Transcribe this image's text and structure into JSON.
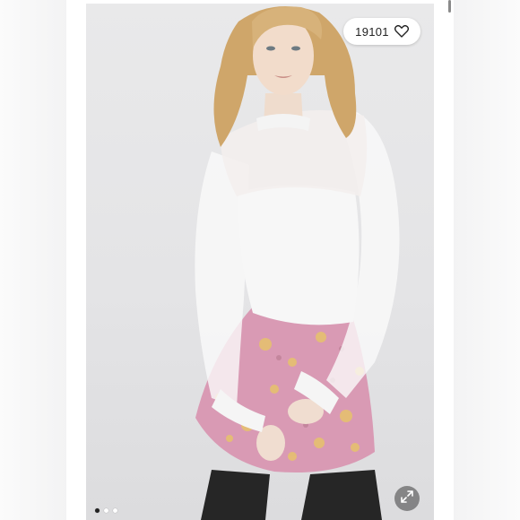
{
  "listing": {
    "likes_count": "19101",
    "like_icon": "heart-icon",
    "expand_icon": "expand-arrows-icon"
  },
  "carousel": {
    "total_images": 3,
    "active_index": 0
  },
  "colors": {
    "backdrop": "#e6e6e8",
    "skirt": "#d99ab4",
    "top": "#f6f6f6",
    "hair": "#d6b27a",
    "tights": "#2a2a2a"
  }
}
